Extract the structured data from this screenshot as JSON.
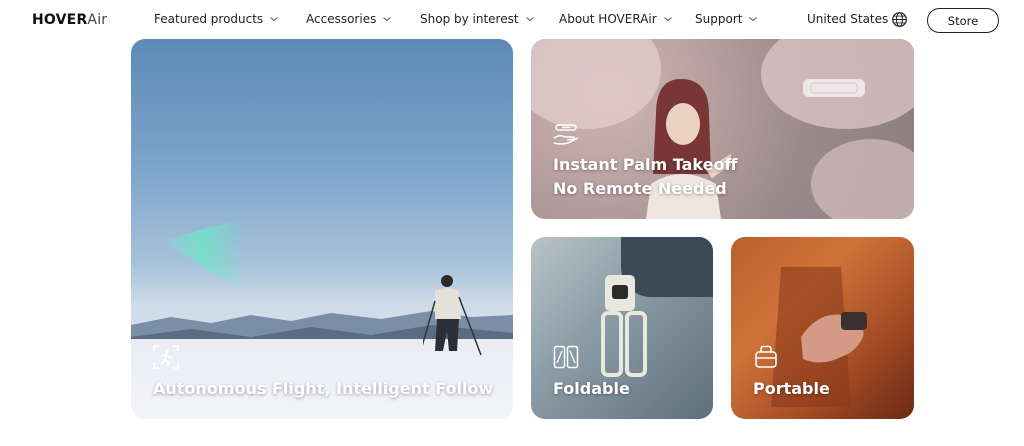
{
  "header": {
    "logo": {
      "bold": "HOVER",
      "light": "Air"
    },
    "nav": [
      {
        "label": "Featured products"
      },
      {
        "label": "Accessories"
      },
      {
        "label": "Shop by interest"
      },
      {
        "label": "About HOVERAir"
      },
      {
        "label": "Support"
      }
    ],
    "region": "United States",
    "store_label": "Store"
  },
  "cards": {
    "follow": {
      "title": "Autonomous Flight, Intelligent Follow",
      "icon": "follow-runner-icon"
    },
    "palm": {
      "title_line1": "Instant Palm Takeoff",
      "title_line2": "No Remote Needed",
      "icon": "palm-takeoff-icon"
    },
    "fold": {
      "title": "Foldable",
      "icon": "fold-icon"
    },
    "port": {
      "title": "Portable",
      "icon": "bag-icon"
    }
  },
  "colors": {
    "accent_text": "#ffffff",
    "nav_text": "#222222"
  }
}
